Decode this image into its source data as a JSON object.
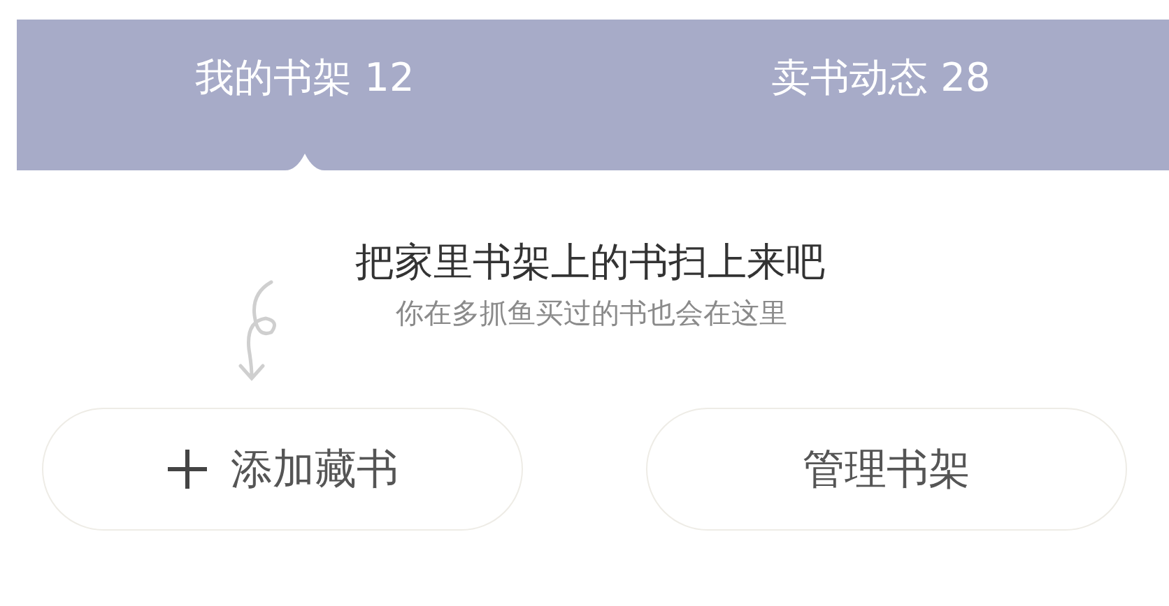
{
  "tabs": [
    {
      "label": "我的书架",
      "count": "12",
      "selected": true
    },
    {
      "label": "卖书动态",
      "count": "28",
      "selected": false
    }
  ],
  "empty_state": {
    "title": "把家里书架上的书扫上来吧",
    "subtitle": "你在多抓鱼买过的书也会在这里"
  },
  "buttons": [
    {
      "kind": "add",
      "label": "添加藏书"
    },
    {
      "kind": "plain",
      "label": "管理书架"
    }
  ]
}
